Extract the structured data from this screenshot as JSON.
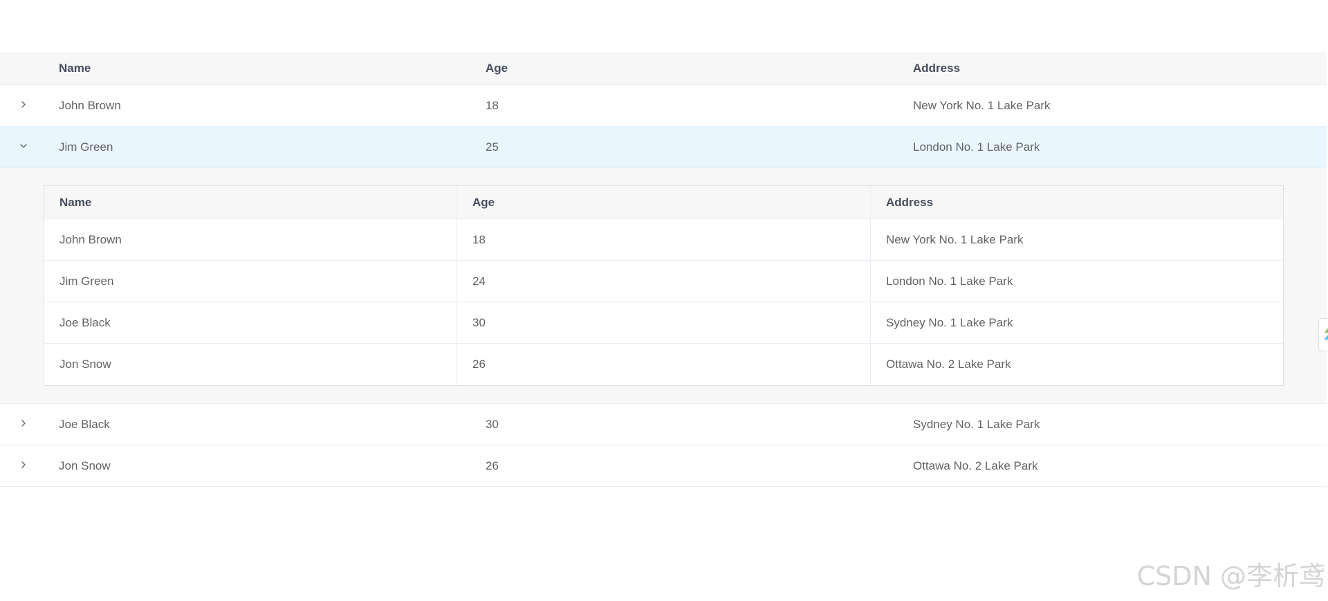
{
  "table": {
    "columns": {
      "name": "Name",
      "age": "Age",
      "address": "Address"
    },
    "rows": [
      {
        "name": "John Brown",
        "age": "18",
        "address": "New York No. 1 Lake Park",
        "expanded": false
      },
      {
        "name": "Jim Green",
        "age": "25",
        "address": "London No. 1 Lake Park",
        "expanded": true
      },
      {
        "name": "Joe Black",
        "age": "30",
        "address": "Sydney No. 1 Lake Park",
        "expanded": false
      },
      {
        "name": "Jon Snow",
        "age": "26",
        "address": "Ottawa No. 2 Lake Park",
        "expanded": false
      }
    ]
  },
  "nested_table": {
    "columns": {
      "name": "Name",
      "age": "Age",
      "address": "Address"
    },
    "rows": [
      {
        "name": "John Brown",
        "age": "18",
        "address": "New York No. 1 Lake Park"
      },
      {
        "name": "Jim Green",
        "age": "24",
        "address": "London No. 1 Lake Park"
      },
      {
        "name": "Joe Black",
        "age": "30",
        "address": "Sydney No. 1 Lake Park"
      },
      {
        "name": "Jon Snow",
        "age": "26",
        "address": "Ottawa No. 2 Lake Park"
      }
    ]
  },
  "icons": {
    "collapsed": "chevron-right-icon",
    "expanded": "chevron-down-icon",
    "side_tab": "side-tab-icon"
  },
  "colors": {
    "header_bg": "#f7f7f7",
    "expanded_row_bg": "#e9f6fd",
    "border": "#ebeef5",
    "text": "#606266",
    "header_text": "#454d5d"
  },
  "watermark": "CSDN @李析鸢"
}
